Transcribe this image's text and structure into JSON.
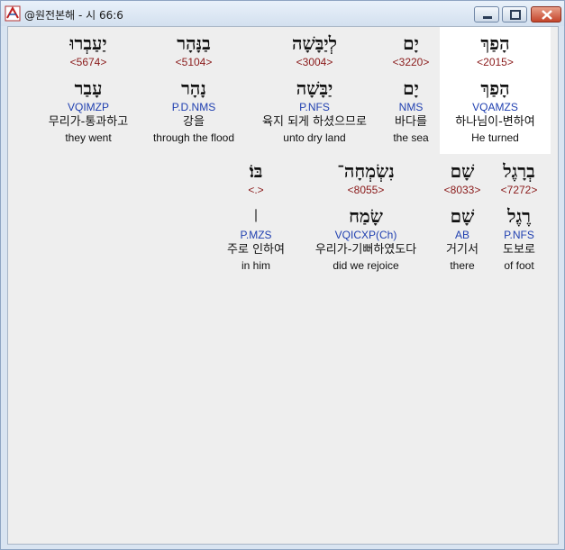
{
  "window": {
    "title": "@원전본해 - 시 66:6"
  },
  "row1": [
    {
      "heb": "הָפַךְ",
      "strong": "<2015>",
      "lemma": "הָפַךְ",
      "morph": "VQAMZS",
      "kor": "하나님이-변하여",
      "eng": "He turned",
      "highlight": true
    },
    {
      "heb": "יָם",
      "strong": "<3220>",
      "lemma": "יָם",
      "morph": "NMS",
      "kor": "바다를",
      "eng": "the sea",
      "highlight": false
    },
    {
      "heb": "לְיַבָּשָׁה",
      "strong": "<3004>",
      "lemma": "יַבָּשָׁה",
      "morph": "P.NFS",
      "kor": "육지 되게 하셨으므로",
      "eng": "unto dry land",
      "highlight": false
    },
    {
      "heb": "בַנָּהָר",
      "strong": "<5104>",
      "lemma": "נָהָר",
      "morph": "P.D.NMS",
      "kor": "강을",
      "eng": "through the flood",
      "highlight": false
    },
    {
      "heb": "יַעַבְרוּ",
      "strong": "<5674>",
      "lemma": "עָבַר",
      "morph": "VQIMZP",
      "kor": "무리가-통과하고",
      "eng": "they went",
      "highlight": false
    }
  ],
  "row2": [
    {
      "heb": "בְרָגֶל",
      "strong": "<7272>",
      "lemma": "רֶגֶל",
      "morph": "P.NFS",
      "kor": "도보로",
      "eng": "of foot"
    },
    {
      "heb": "שָׁם",
      "strong": "<8033>",
      "lemma": "שָׁם",
      "morph": "AB",
      "kor": "거기서",
      "eng": "there"
    },
    {
      "heb": "נִשְׂמְחָה־",
      "strong": "<8055>",
      "lemma": "שָׂמַח",
      "morph": "VQICXP(Ch)",
      "kor": "우리가-기뻐하였도다",
      "eng": "did we rejoice"
    },
    {
      "heb": "בּוֹ׃",
      "strong": "<.>",
      "lemma": "׀",
      "morph": "P.MZS",
      "kor": "주로 인하여",
      "eng": "in him"
    }
  ]
}
